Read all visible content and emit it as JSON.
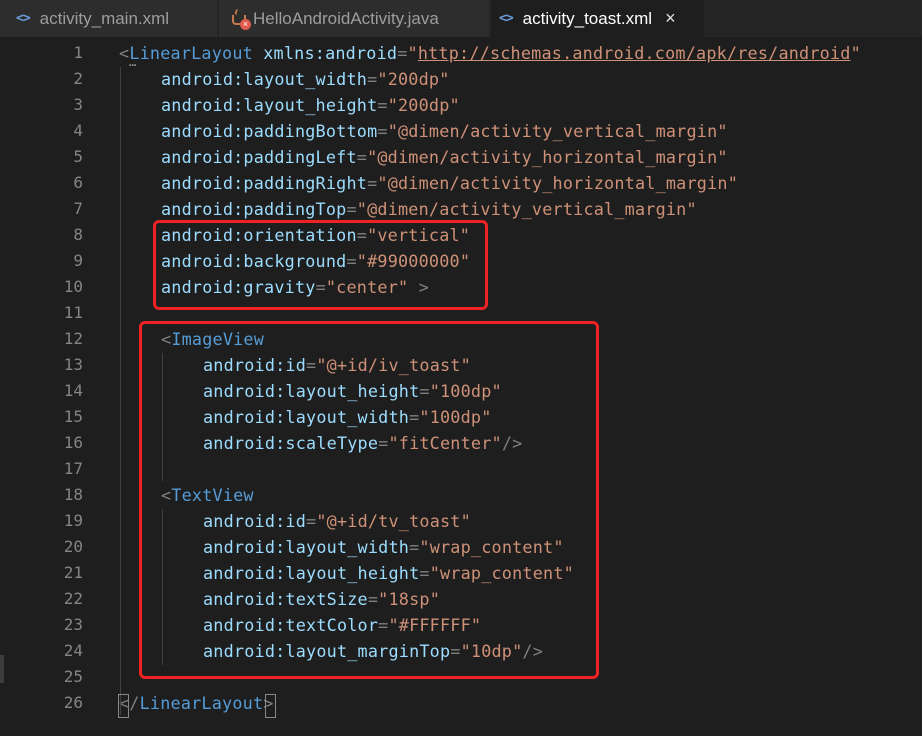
{
  "tabs": [
    {
      "label": "activity_main.xml",
      "icon": "xml-icon"
    },
    {
      "label": "HelloAndroidActivity.java",
      "icon": "java-error-icon"
    },
    {
      "label": "activity_toast.xml",
      "icon": "xml-icon",
      "active": true
    }
  ],
  "tab_icon_text": "<>",
  "close_symbol": "×",
  "colors": {
    "background": "#1e1e1e",
    "tag": "#569cd6",
    "attribute": "#9cdcfe",
    "string": "#ce9178",
    "punctuation": "#808080",
    "highlight": "#ee2222"
  },
  "lines": [
    {
      "n": "1",
      "indent": 0,
      "tokens": [
        [
          "punc",
          "<"
        ],
        [
          "tag",
          "LinearLayout"
        ],
        [
          "attr",
          " xmlns:android"
        ],
        [
          "punc",
          "="
        ],
        [
          "val",
          "\""
        ],
        [
          "url",
          "http://schemas.android.com/apk/res/android"
        ],
        [
          "val",
          "\""
        ]
      ]
    },
    {
      "n": "2",
      "indent": 1,
      "tokens": [
        [
          "attr",
          "android:layout_width"
        ],
        [
          "punc",
          "="
        ],
        [
          "val",
          "\"200dp\""
        ]
      ]
    },
    {
      "n": "3",
      "indent": 1,
      "tokens": [
        [
          "attr",
          "android:layout_height"
        ],
        [
          "punc",
          "="
        ],
        [
          "val",
          "\"200dp\""
        ]
      ]
    },
    {
      "n": "4",
      "indent": 1,
      "tokens": [
        [
          "attr",
          "android:paddingBottom"
        ],
        [
          "punc",
          "="
        ],
        [
          "val",
          "\"@dimen/activity_vertical_margin\""
        ]
      ]
    },
    {
      "n": "5",
      "indent": 1,
      "tokens": [
        [
          "attr",
          "android:paddingLeft"
        ],
        [
          "punc",
          "="
        ],
        [
          "val",
          "\"@dimen/activity_horizontal_margin\""
        ]
      ]
    },
    {
      "n": "6",
      "indent": 1,
      "tokens": [
        [
          "attr",
          "android:paddingRight"
        ],
        [
          "punc",
          "="
        ],
        [
          "val",
          "\"@dimen/activity_horizontal_margin\""
        ]
      ]
    },
    {
      "n": "7",
      "indent": 1,
      "tokens": [
        [
          "attr",
          "android:paddingTop"
        ],
        [
          "punc",
          "="
        ],
        [
          "val",
          "\"@dimen/activity_vertical_margin\""
        ]
      ]
    },
    {
      "n": "8",
      "indent": 1,
      "tokens": [
        [
          "attr",
          "android:orientation"
        ],
        [
          "punc",
          "="
        ],
        [
          "val",
          "\"vertical\""
        ]
      ]
    },
    {
      "n": "9",
      "indent": 1,
      "tokens": [
        [
          "attr",
          "android:background"
        ],
        [
          "punc",
          "="
        ],
        [
          "val",
          "\"#99000000\""
        ]
      ]
    },
    {
      "n": "10",
      "indent": 1,
      "tokens": [
        [
          "attr",
          "android:gravity"
        ],
        [
          "punc",
          "="
        ],
        [
          "val",
          "\"center\""
        ],
        [
          "punc",
          " >"
        ]
      ]
    },
    {
      "n": "11",
      "indent": 0,
      "tokens": []
    },
    {
      "n": "12",
      "indent": 1,
      "tokens": [
        [
          "punc",
          "<"
        ],
        [
          "tag",
          "ImageView"
        ]
      ]
    },
    {
      "n": "13",
      "indent": 2,
      "tokens": [
        [
          "attr",
          "android:id"
        ],
        [
          "punc",
          "="
        ],
        [
          "val",
          "\"@+id/iv_toast\""
        ]
      ]
    },
    {
      "n": "14",
      "indent": 2,
      "tokens": [
        [
          "attr",
          "android:layout_height"
        ],
        [
          "punc",
          "="
        ],
        [
          "val",
          "\"100dp\""
        ]
      ]
    },
    {
      "n": "15",
      "indent": 2,
      "tokens": [
        [
          "attr",
          "android:layout_width"
        ],
        [
          "punc",
          "="
        ],
        [
          "val",
          "\"100dp\""
        ]
      ]
    },
    {
      "n": "16",
      "indent": 2,
      "tokens": [
        [
          "attr",
          "android:scaleType"
        ],
        [
          "punc",
          "="
        ],
        [
          "val",
          "\"fitCenter\""
        ],
        [
          "punc",
          "/>"
        ]
      ]
    },
    {
      "n": "17",
      "indent": 0,
      "tokens": []
    },
    {
      "n": "18",
      "indent": 1,
      "tokens": [
        [
          "punc",
          "<"
        ],
        [
          "tag",
          "TextView"
        ]
      ]
    },
    {
      "n": "19",
      "indent": 2,
      "tokens": [
        [
          "attr",
          "android:id"
        ],
        [
          "punc",
          "="
        ],
        [
          "val",
          "\"@+id/tv_toast\""
        ]
      ]
    },
    {
      "n": "20",
      "indent": 2,
      "tokens": [
        [
          "attr",
          "android:layout_width"
        ],
        [
          "punc",
          "="
        ],
        [
          "val",
          "\"wrap_content\""
        ]
      ]
    },
    {
      "n": "21",
      "indent": 2,
      "tokens": [
        [
          "attr",
          "android:layout_height"
        ],
        [
          "punc",
          "="
        ],
        [
          "val",
          "\"wrap_content\""
        ]
      ]
    },
    {
      "n": "22",
      "indent": 2,
      "tokens": [
        [
          "attr",
          "android:textSize"
        ],
        [
          "punc",
          "="
        ],
        [
          "val",
          "\"18sp\""
        ]
      ]
    },
    {
      "n": "23",
      "indent": 2,
      "tokens": [
        [
          "attr",
          "android:textColor"
        ],
        [
          "punc",
          "="
        ],
        [
          "val",
          "\"#FFFFFF\""
        ]
      ]
    },
    {
      "n": "24",
      "indent": 2,
      "tokens": [
        [
          "attr",
          "android:layout_marginTop"
        ],
        [
          "punc",
          "="
        ],
        [
          "val",
          "\"10dp\""
        ],
        [
          "punc",
          "/>"
        ]
      ]
    },
    {
      "n": "25",
      "indent": 0,
      "tokens": []
    },
    {
      "n": "26",
      "indent": 0,
      "tokens": [
        [
          "punc",
          "</"
        ],
        [
          "tag",
          "LinearLayout"
        ],
        [
          "punc",
          ">"
        ]
      ]
    }
  ]
}
